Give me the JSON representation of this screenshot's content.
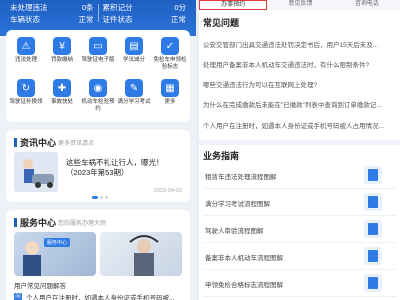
{
  "stats": {
    "row1_left_label": "未处理违法",
    "row1_left_value": "0条",
    "row1_right_label": "累积记分",
    "row1_right_value": "0分",
    "row2_left_label": "车辆状态",
    "row2_left_value": "正常",
    "row2_right_label": "证件状态",
    "row2_right_value": "正常"
  },
  "services": [
    {
      "label": "违法处理",
      "icon": "violation-icon"
    },
    {
      "label": "罚款缴纳",
      "icon": "fine-icon"
    },
    {
      "label": "驾驶证电子版",
      "icon": "license-icon"
    },
    {
      "label": "学法减分",
      "icon": "study-icon"
    },
    {
      "label": "免检车申领检验标志",
      "icon": "car-check-icon"
    },
    {
      "label": "驾驶证补换领",
      "icon": "license-renew-icon"
    },
    {
      "label": "事故快处",
      "icon": "accident-icon"
    },
    {
      "label": "机动车检验预约",
      "icon": "inspection-icon"
    },
    {
      "label": "满分学习考试",
      "icon": "exam-icon"
    },
    {
      "label": "更多",
      "icon": "more-icon"
    }
  ],
  "news": {
    "title": "资讯中心",
    "more": "更多资讯请点",
    "headline": "这些车祸不礼让行人，曝光！（2023年第53期）",
    "date": "2023-04-03"
  },
  "service_center": {
    "title": "服务中心",
    "more": "您的服务办理大师",
    "banner_tag": "服务中心",
    "q_text": "用户常见问题解答",
    "a_text": "个人用户在注册时，如遇本人身份证或手机号码被..."
  },
  "tabs": [
    "办事预约",
    "意见反馈",
    "咨询电话"
  ],
  "faq_title": "常见问题",
  "faqs": [
    "公安交管部门出具交通违法处罚决定书后，用户15天后未及...",
    "处理用户备案非本人机动车交通违法时，有什么限制条件?",
    "哪些交通违法行为可以在互联网上处理?",
    "为什么在完成缴款后未能在“已缴款”列表中查询到订单缴款记...",
    "个人用户在注册时，如遇本人身份证或手机号码被人占用情况..."
  ],
  "guide_title": "业务指南",
  "guides": [
    "租赁车违法处理流程图解",
    "满分学习考试流程图解",
    "驾驶人审验流程图解",
    "备案非本人机动车流程图解",
    "申领免检合格标志流程图解"
  ]
}
